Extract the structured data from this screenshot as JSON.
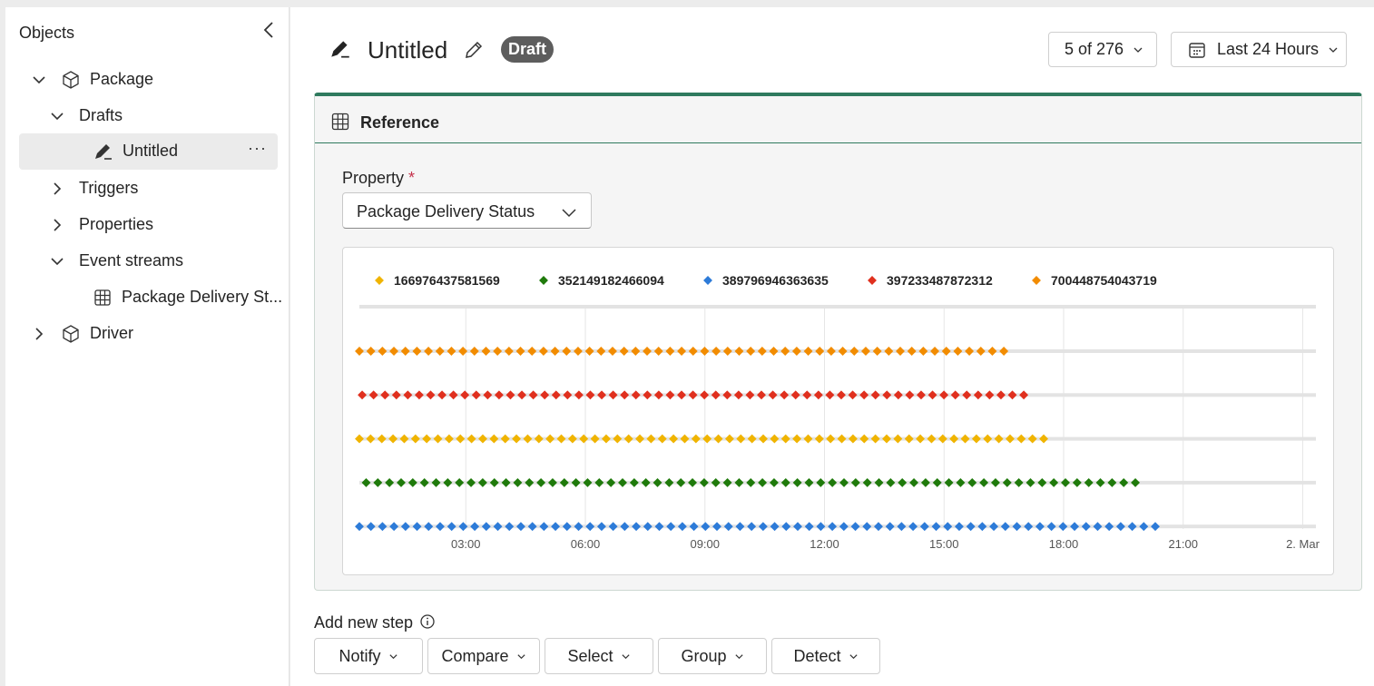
{
  "sidebar": {
    "title": "Objects",
    "tree": [
      {
        "label": "Package"
      },
      {
        "label": "Drafts"
      },
      {
        "label": "Untitled"
      },
      {
        "label": "Triggers"
      },
      {
        "label": "Properties"
      },
      {
        "label": "Event streams"
      },
      {
        "label": "Package Delivery St..."
      },
      {
        "label": "Driver"
      }
    ]
  },
  "header": {
    "title": "Untitled",
    "badge": "Draft",
    "pager": "5 of 276",
    "range": "Last 24 Hours"
  },
  "card": {
    "title": "Reference",
    "property_label": "Property",
    "required_mark": "*",
    "property_value": "Package Delivery Status"
  },
  "chart_data": {
    "type": "scatter",
    "x_ticks": [
      "03:00",
      "06:00",
      "09:00",
      "12:00",
      "15:00",
      "18:00",
      "21:00",
      "2. Mar"
    ],
    "xlim_hours": [
      0.33,
      24.33
    ],
    "legend_position": "top-left",
    "series": [
      {
        "name": "166976437581569",
        "color": "#f0b400",
        "row": 3,
        "start_hour": 0.33,
        "end_hour": 17.5,
        "points": 62
      },
      {
        "name": "352149182466094",
        "color": "#1f7a0b",
        "row": 4,
        "start_hour": 0.5,
        "end_hour": 19.8,
        "points": 67
      },
      {
        "name": "389796946363635",
        "color": "#2d7bd8",
        "row": 5,
        "start_hour": 0.33,
        "end_hour": 20.3,
        "points": 70
      },
      {
        "name": "397233487872312",
        "color": "#e0301e",
        "row": 2,
        "start_hour": 0.4,
        "end_hour": 17.0,
        "points": 59
      },
      {
        "name": "700448754043719",
        "color": "#f28c00",
        "row": 1,
        "start_hour": 0.33,
        "end_hour": 16.5,
        "points": 57
      }
    ]
  },
  "add_step": {
    "label": "Add new step",
    "buttons": [
      {
        "label": "Notify"
      },
      {
        "label": "Compare"
      },
      {
        "label": "Select"
      },
      {
        "label": "Group"
      },
      {
        "label": "Detect"
      }
    ]
  }
}
